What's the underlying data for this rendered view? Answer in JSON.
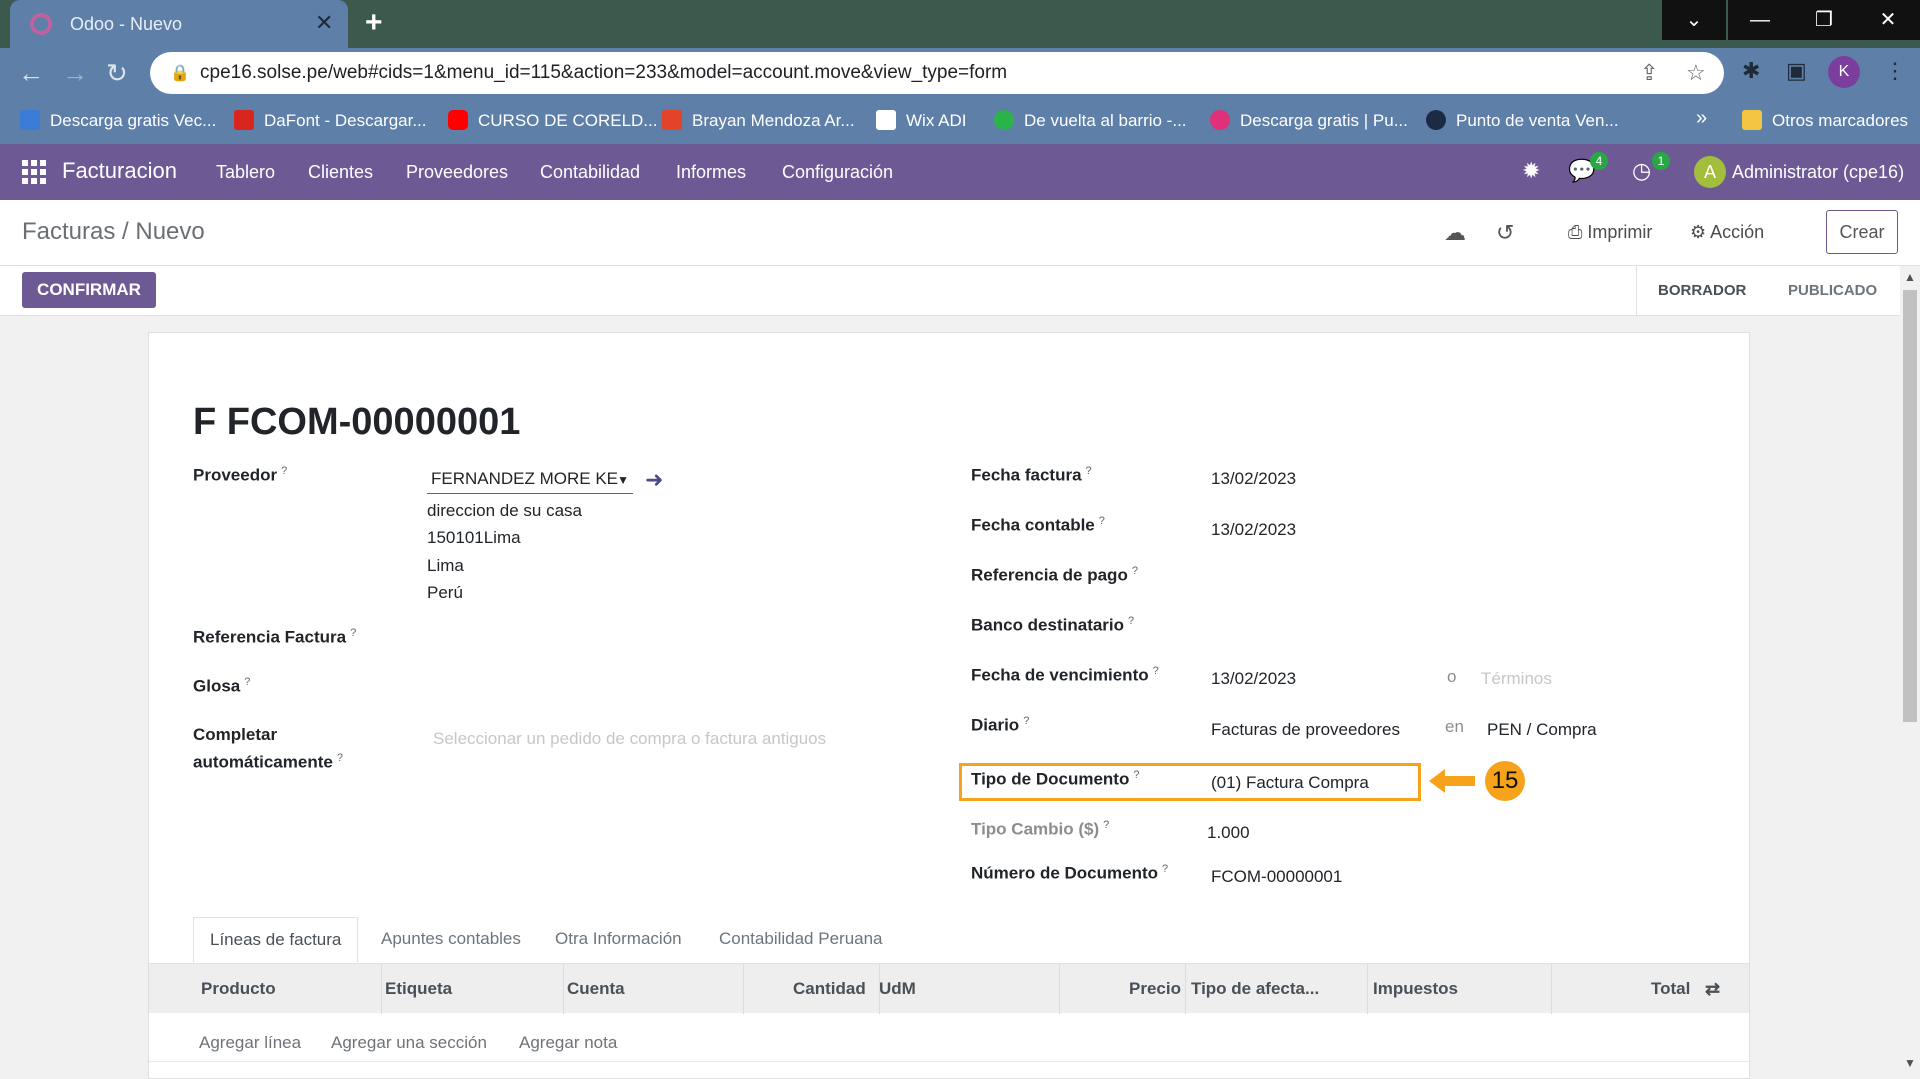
{
  "browser": {
    "tab_title": "Odoo - Nuevo",
    "tab_close": "✕",
    "new_tab": "+",
    "url": "cpe16.solse.pe/web#cids=1&menu_id=115&action=233&model=account.move&view_type=form",
    "profile_initial": "K",
    "bookmarks": [
      "Descarga gratis Vec...",
      "DaFont - Descargar...",
      "CURSO DE CORELD...",
      "Brayan Mendoza Ar...",
      "Wix ADI",
      "De vuelta al barrio -...",
      "Descarga gratis | Pu...",
      "Punto de venta Ven..."
    ],
    "bookmarks_more": "»",
    "other_bookmarks": "Otros marcadores"
  },
  "navbar": {
    "app_name": "Facturacion",
    "menu": [
      "Tablero",
      "Clientes",
      "Proveedores",
      "Contabilidad",
      "Informes",
      "Configuración"
    ],
    "messages_count": "4",
    "activities_count": "1",
    "user_initial": "A",
    "user_name": "Administrator (cpe16)"
  },
  "control_panel": {
    "breadcrumb": "Facturas / Nuevo",
    "print_label": "Imprimir",
    "action_label": "Acción",
    "create_label": "Crear"
  },
  "statusbar": {
    "confirm_label": "CONFIRMAR",
    "stages": [
      "BORRADOR",
      "PUBLICADO"
    ]
  },
  "form": {
    "title": "F FCOM-00000001",
    "left": {
      "proveedor_label": "Proveedor",
      "proveedor_value": "FERNANDEZ MORE KE",
      "address": [
        "direccion de su casa",
        "150101Lima",
        "Lima",
        "Perú"
      ],
      "ref_factura_label": "Referencia Factura",
      "glosa_label": "Glosa",
      "completar_label_1": "Completar",
      "completar_label_2": "automáticamente",
      "completar_placeholder": "Seleccionar un pedido de compra o factura antiguos"
    },
    "right": {
      "fecha_factura_label": "Fecha factura",
      "fecha_factura": "13/02/2023",
      "fecha_contable_label": "Fecha contable",
      "fecha_contable": "13/02/2023",
      "ref_pago_label": "Referencia de pago",
      "banco_label": "Banco destinatario",
      "vencimiento_label": "Fecha de vencimiento",
      "vencimiento": "13/02/2023",
      "o_text": "o",
      "terminos_placeholder": "Términos",
      "diario_label": "Diario",
      "diario": "Facturas de proveedores",
      "en_text": "en",
      "moneda": "PEN / Compra",
      "tipo_doc_label": "Tipo de Documento",
      "tipo_doc": "(01) Factura Compra",
      "tipo_cambio_label": "Tipo Cambio ($)",
      "tipo_cambio": "1.000",
      "numero_doc_label": "Número de Documento",
      "numero_doc": "FCOM-00000001"
    },
    "annotation_number": "15",
    "tabs": [
      "Líneas de factura",
      "Apuntes contables",
      "Otra Información",
      "Contabilidad Peruana"
    ],
    "grid_headers": [
      "Producto",
      "Etiqueta",
      "Cuenta",
      "Cantidad",
      "UdM",
      "Precio",
      "Tipo de afecta...",
      "Impuestos",
      "Total"
    ],
    "add_links": [
      "Agregar línea",
      "Agregar una sección",
      "Agregar nota"
    ]
  },
  "colors": {
    "navbar": "#6d5a95",
    "highlight": "#f7a21b",
    "browser_chrome": "#5e7fa8"
  }
}
